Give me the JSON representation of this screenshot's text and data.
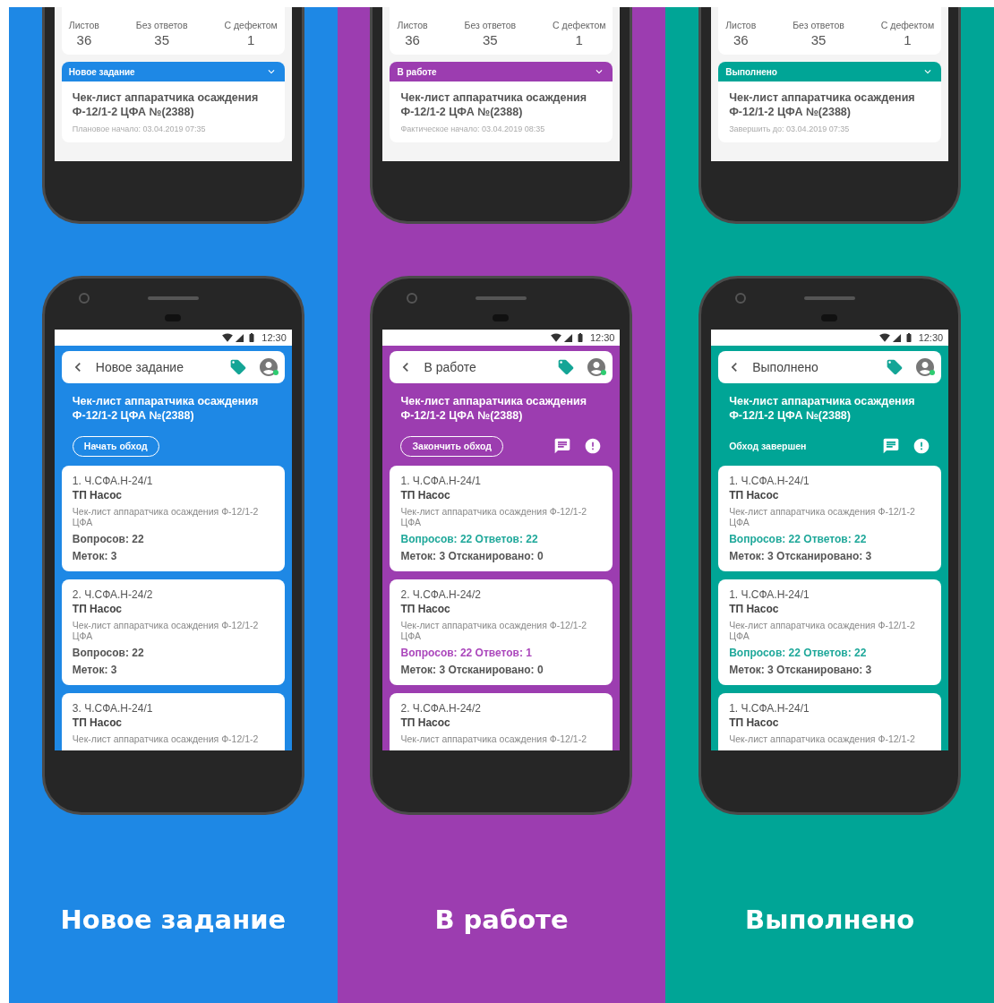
{
  "columns": [
    {
      "color": "#1e88e5",
      "caption": "Новое задание",
      "top_phone": {
        "stats": [
          {
            "label": "Листов",
            "value": "36"
          },
          {
            "label": "Без ответов",
            "value": "35"
          },
          {
            "label": "С дефектом",
            "value": "1"
          }
        ],
        "status": "Новое задание",
        "task_title": "Чек-лист аппаратчика осаждения Ф-12/1-2 ЦФА №(2388)",
        "task_date": "Плановое начало: 03.04.2019 07:35"
      },
      "bottom_phone": {
        "time": "12:30",
        "title": "Новое задание",
        "task_title": "Чек-лист аппаратчика осаждения Ф-12/1-2 ЦФА №(2388)",
        "action": {
          "kind": "button",
          "label": "Начать обход"
        },
        "show_icons": false,
        "cards": [
          {
            "code": "1. Ч.СФА.Н-24/1",
            "name": "ТП Насос",
            "description": "Чек-лист аппаратчика осаждения Ф-12/1-2 ЦФА",
            "questions": "Вопросов: 22",
            "color": "#555555",
            "marks": "Меток: 3"
          },
          {
            "code": "2. Ч.СФА.Н-24/2",
            "name": "ТП Насос",
            "description": "Чек-лист аппаратчика осаждения Ф-12/1-2 ЦФА",
            "questions": "Вопросов: 22",
            "color": "#555555",
            "marks": "Меток: 3"
          },
          {
            "code": "3. Ч.СФА.Н-24/1",
            "name": "ТП Насос",
            "description": "Чек-лист аппаратчика осаждения Ф-12/1-2"
          }
        ]
      }
    },
    {
      "color": "#9c3db0",
      "caption": "В работе",
      "top_phone": {
        "stats": [
          {
            "label": "Листов",
            "value": "36"
          },
          {
            "label": "Без ответов",
            "value": "35"
          },
          {
            "label": "С дефектом",
            "value": "1"
          }
        ],
        "status": "В работе",
        "task_title": "Чек-лист аппаратчика осаждения Ф-12/1-2 ЦФА №(2388)",
        "task_date": "Фактическое начало: 03.04.2019 08:35"
      },
      "bottom_phone": {
        "time": "12:30",
        "title": "В работе",
        "task_title": "Чек-лист аппаратчика осаждения Ф-12/1-2 ЦФА №(2388)",
        "action": {
          "kind": "button",
          "label": "Закончить обход"
        },
        "show_icons": true,
        "cards": [
          {
            "code": "1. Ч.СФА.Н-24/1",
            "name": "ТП Насос",
            "description": "Чек-лист аппаратчика осаждения Ф-12/1-2 ЦФА",
            "questions": "Вопросов: 22 Ответов: 22",
            "color": "#1fa89a",
            "marks": "Меток: 3 Отсканировано: 0"
          },
          {
            "code": "2. Ч.СФА.Н-24/2",
            "name": "ТП Насос",
            "description": "Чек-лист аппаратчика осаждения Ф-12/1-2 ЦФА",
            "questions": "Вопросов: 22 Ответов: 1",
            "color": "#ab47bc",
            "marks": "Меток: 3 Отсканировано: 0"
          },
          {
            "code": "2. Ч.СФА.Н-24/2",
            "name": "ТП Насос",
            "description": "Чек-лист аппаратчика осаждения Ф-12/1-2"
          }
        ]
      }
    },
    {
      "color": "#00a596",
      "caption": "Выполнено",
      "top_phone": {
        "stats": [
          {
            "label": "Листов",
            "value": "36"
          },
          {
            "label": "Без ответов",
            "value": "35"
          },
          {
            "label": "С дефектом",
            "value": "1"
          }
        ],
        "status": "Выполнено",
        "task_title": "Чек-лист аппаратчика осаждения Ф-12/1-2 ЦФА №(2388)",
        "task_date": "Завершить до: 03.04.2019 07:35"
      },
      "bottom_phone": {
        "time": "12:30",
        "title": "Выполнено",
        "task_title": "Чек-лист аппаратчика осаждения Ф-12/1-2 ЦФА №(2388)",
        "action": {
          "kind": "text",
          "label": "Обход завершен"
        },
        "show_icons": true,
        "cards": [
          {
            "code": "1. Ч.СФА.Н-24/1",
            "name": "ТП Насос",
            "description": "Чек-лист аппаратчика осаждения Ф-12/1-2 ЦФА",
            "questions": "Вопросов: 22 Ответов: 22",
            "color": "#1fa89a",
            "marks": "Меток: 3 Отсканировано: 3"
          },
          {
            "code": "1. Ч.СФА.Н-24/1",
            "name": "ТП Насос",
            "description": "Чек-лист аппаратчика осаждения Ф-12/1-2 ЦФА",
            "questions": "Вопросов: 22 Ответов: 22",
            "color": "#1fa89a",
            "marks": "Меток: 3 Отсканировано: 3"
          },
          {
            "code": "1. Ч.СФА.Н-24/1",
            "name": "ТП Насос",
            "description": "Чек-лист аппаратчика осаждения Ф-12/1-2"
          }
        ]
      }
    }
  ]
}
